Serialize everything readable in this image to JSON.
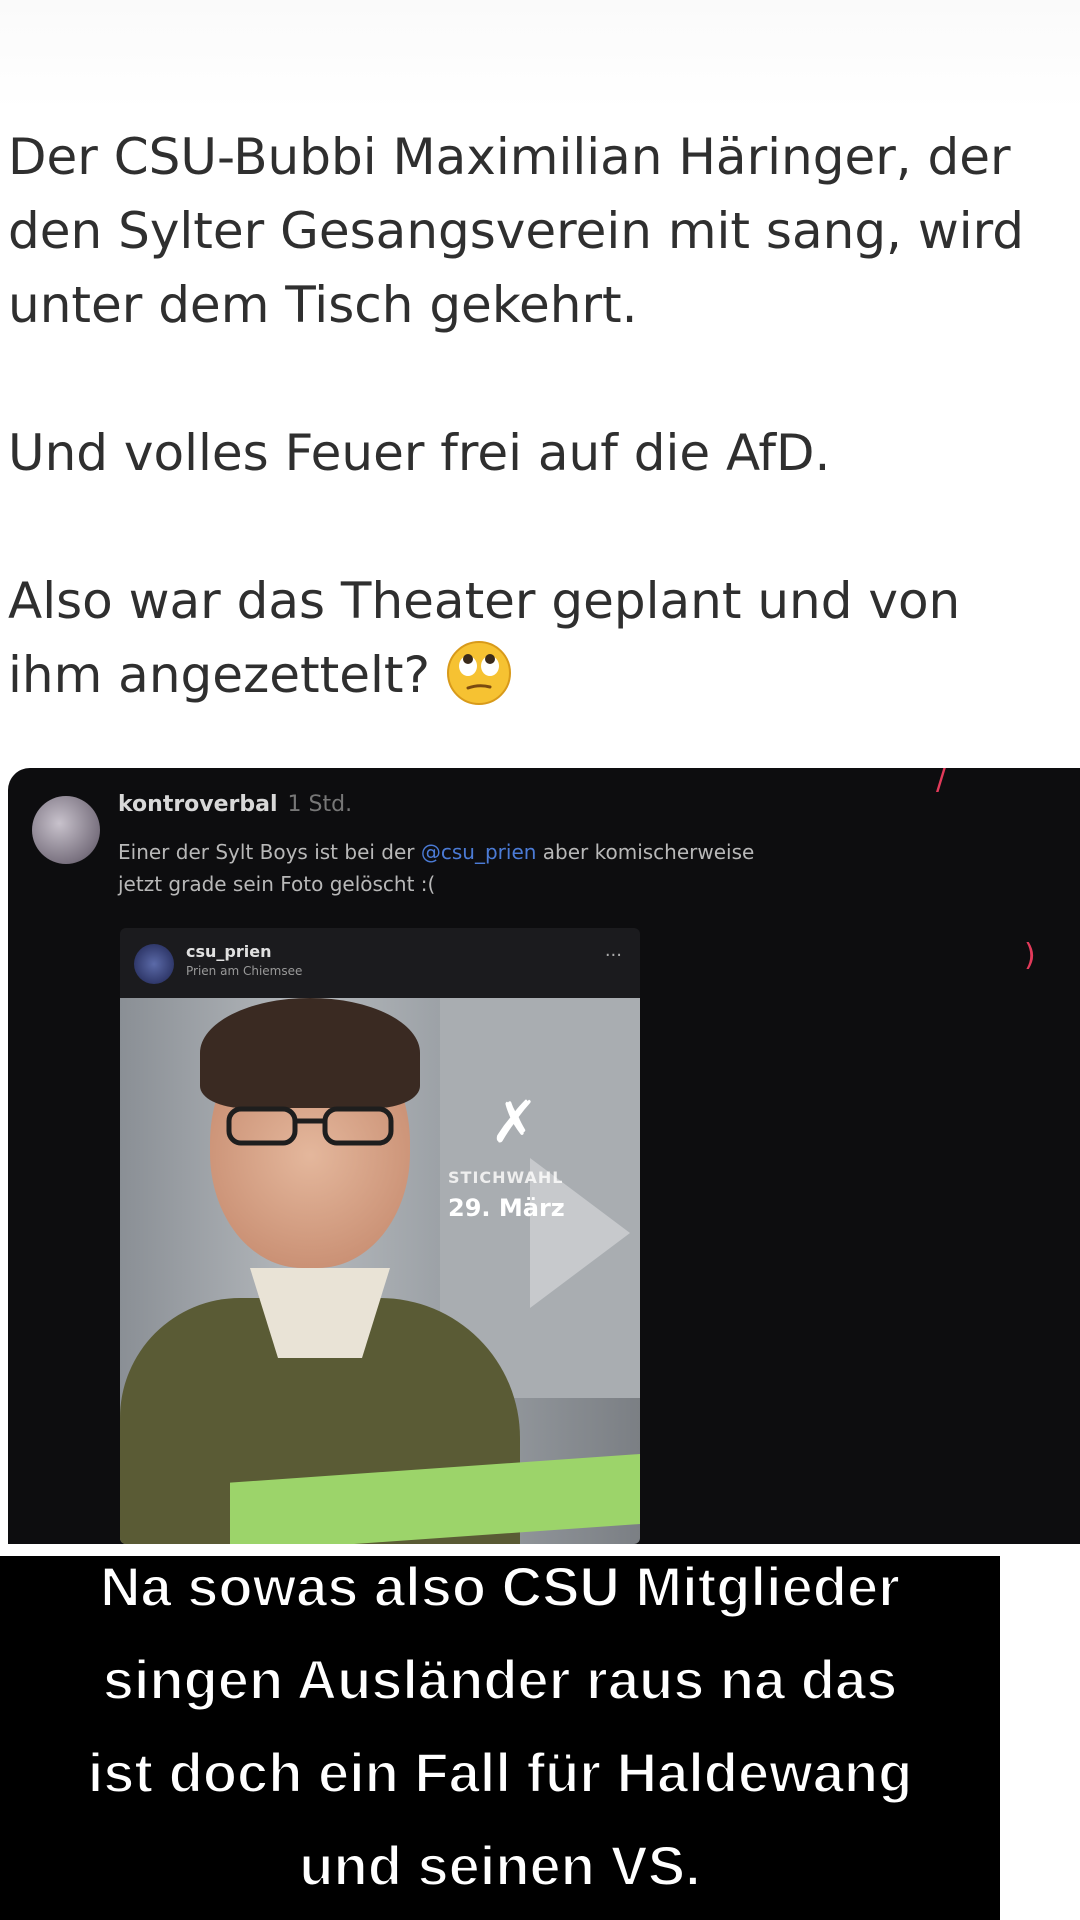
{
  "tweet": {
    "paragraphs": [
      "Der CSU-Bubbi Maximilian Häringer, der den Sylter Gesangsverein mit sang, wird unter dem Tisch gekehrt.",
      "Und volles Feuer frei auf die AfD.",
      "Also war das Theater geplant und von ihm angezettelt?"
    ],
    "lines": [
      "Der CSU-Bubbi Maximilian Häringer, der",
      "den Sylter Gesangsverein mit sang, wird",
      "unter dem Tisch gekehrt.",
      "Und volles Feuer frei auf die AfD.",
      "Also war das Theater geplant und von",
      "ihm angezettelt?"
    ],
    "emoji": "face-with-rolling-eyes"
  },
  "embed": {
    "username": "kontroverbal",
    "time": "1 Std.",
    "text_line1_before": "Einer der Sylt Boys ist bei der ",
    "mention": "@csu_prien",
    "text_line1_after": " aber komischerweise",
    "text_line2": "jetzt grade sein Foto gelöscht :(",
    "inner_post": {
      "account": "csu_prien",
      "location": "Prien am Chiemsee",
      "more": "...",
      "image_label": "STICHWAHL",
      "image_date": "29. März"
    }
  },
  "caption": {
    "lines": [
      "Na sowas also CSU Mitglieder",
      "singen Ausländer raus na das",
      "ist doch ein Fall für Haldewang",
      "und seinen VS."
    ]
  },
  "colors": {
    "caption_bg": "#000000",
    "caption_text": "#ffffff",
    "tweet_text": "#2f2f2f",
    "embed_bg": "#0d0d0f",
    "mention": "#4b7bd6"
  }
}
